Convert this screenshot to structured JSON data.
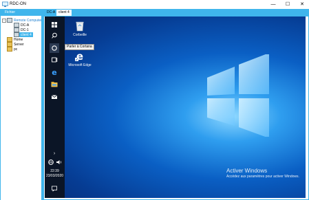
{
  "window": {
    "title": "RDC-ON",
    "minimize": "—",
    "maximize": "☐",
    "close": "✕"
  },
  "menu": {
    "file": "Fichier"
  },
  "tree": {
    "root": "Remote Computer",
    "items": [
      {
        "label": "DC-A",
        "type": "pc"
      },
      {
        "label": "DC-1",
        "type": "pc"
      },
      {
        "label": "client 4",
        "type": "pc",
        "selected": true
      }
    ],
    "groups": [
      {
        "label": "Home"
      },
      {
        "label": "Server"
      },
      {
        "label": "pc"
      }
    ]
  },
  "tabs": [
    {
      "label": "DC-A"
    },
    {
      "label": "client 4",
      "active": true
    }
  ],
  "desktop": {
    "icons": [
      {
        "label": "Corbeille"
      },
      {
        "label": "Microsoft Edge"
      }
    ],
    "tooltip": "Parler à Cortana",
    "activation": {
      "title": "Activer Windows",
      "subtitle": "Accédez aux paramètres pour activer Windows."
    }
  },
  "taskbar": {
    "time": "22:39",
    "date": "23/03/2020"
  },
  "colors": {
    "accent": "#3fb5ec",
    "desktop": "#0a5fc4",
    "taskbar": "#0b1526"
  }
}
